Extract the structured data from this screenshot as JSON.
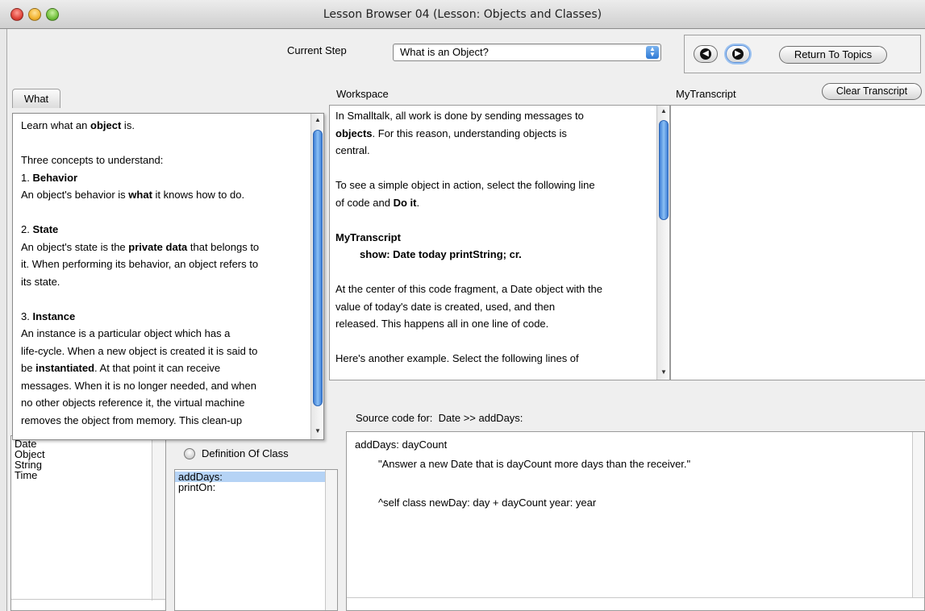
{
  "window": {
    "title": "Lesson Browser 04 (Lesson: Objects and Classes)"
  },
  "header": {
    "current_step_label": "Current Step",
    "current_step_value": "What is an Object?",
    "return_button": "Return To Topics",
    "back_icon": "left-arrow-icon",
    "forward_icon": "right-arrow-icon"
  },
  "what_pane": {
    "tab_label": "What",
    "lines": [
      {
        "t": "Learn what an "
      },
      {
        "b": "object"
      },
      {
        "t": " is."
      }
    ],
    "l1a": "Learn what an ",
    "l1b": "object",
    "l1c": " is.",
    "l2": "Three concepts to understand:",
    "l3a": "1. ",
    "l3b": "Behavior",
    "l4a": "An object's behavior is ",
    "l4b": "what",
    "l4c": " it knows how to do.",
    "l5a": "2. ",
    "l5b": "State",
    "l6a": "An object's state is the ",
    "l6b": "private data",
    "l6c": " that belongs to",
    "l7": "it. When performing its behavior, an object refers to",
    "l8": "its state.",
    "l9a": "3. ",
    "l9b": "Instance",
    "l10": "An instance is a particular object which has a",
    "l11": "life-cycle. When a new object is created it is said to",
    "l12a": "be ",
    "l12b": "instantiated",
    "l12c": ". At that point it can receive",
    "l13": "messages. When it is no longer needed, and when",
    "l14": "no other objects reference it, the virtual machine",
    "l15": "removes the object from memory. This clean-up"
  },
  "workspace": {
    "label": "Workspace",
    "l1": "In Smalltalk, all work is done by sending messages to",
    "l2a": "objects",
    "l2b": ". For this reason, understanding objects is",
    "l3": "central.",
    "l4": "To see a simple object in action, select the following line",
    "l5a": "of code and ",
    "l5b": "Do it",
    "l5c": ".",
    "l6": "MyTranscript",
    "l7": "show: Date today printString; cr.",
    "l8": "At the center of this code fragment, a Date object with the",
    "l9": "value of today's date is created, used, and then",
    "l10": "released. This happens all in one line of code.",
    "l11": "Here's another example. Select the following lines of"
  },
  "transcript": {
    "label": "MyTranscript",
    "clear_button": "Clear Transcript"
  },
  "class_list": {
    "partial_top": "Date",
    "items": [
      "Object",
      "String",
      "Time"
    ]
  },
  "method_list": {
    "radio_label": "Definition Of Class",
    "items": [
      "addDays:",
      "printOn:"
    ],
    "selected_index": 0
  },
  "source": {
    "label_prefix": "Source code for:",
    "label_value": "Date >> addDays:",
    "l1": "addDays: dayCount",
    "l2": "\"Answer a new Date that is dayCount more days than the receiver.\"",
    "l3": "^self class newDay: day + dayCount year: year"
  }
}
